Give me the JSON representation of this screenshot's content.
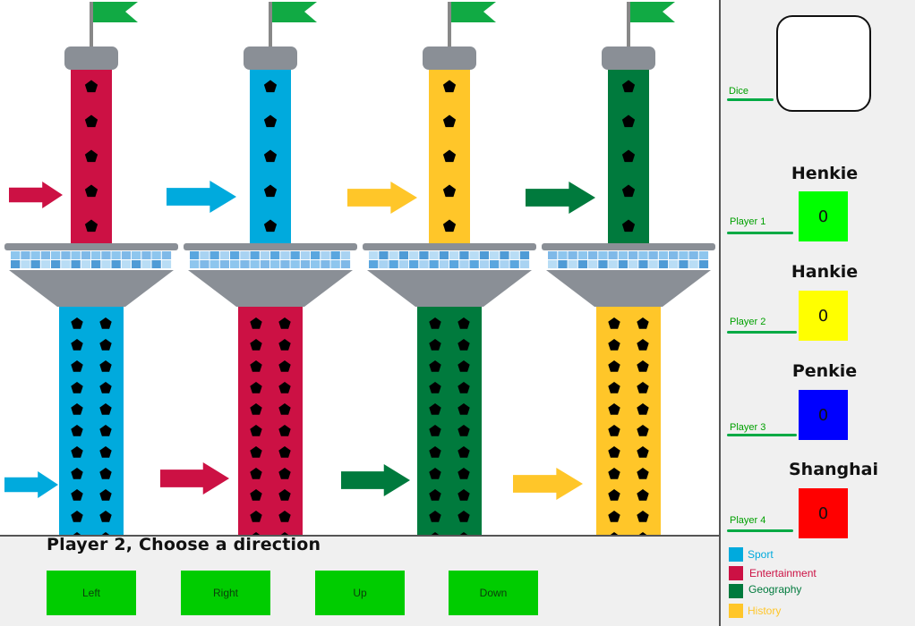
{
  "colors": {
    "sport": "#00aadd",
    "entertainment": "#cc1144",
    "geography": "#007a3d",
    "history": "#ffc629",
    "button_green": "#00cc00",
    "flag": "#11aa44"
  },
  "towers": [
    {
      "top_category": "entertainment",
      "bottom_category": "sport"
    },
    {
      "top_category": "sport",
      "bottom_category": "entertainment"
    },
    {
      "top_category": "history",
      "bottom_category": "geography"
    },
    {
      "top_category": "geography",
      "bottom_category": "history"
    }
  ],
  "controls": {
    "prompt": "Player 2, Choose a direction",
    "buttons": [
      "Left",
      "Right",
      "Up",
      "Down"
    ]
  },
  "sidebar": {
    "dice_label": "Dice",
    "players": [
      {
        "label": "Player 1",
        "name": "Henkie",
        "score": "0",
        "color": "#00ff00"
      },
      {
        "label": "Player 2",
        "name": "Hankie",
        "score": "0",
        "color": "#ffff00"
      },
      {
        "label": "Player 3",
        "name": "Penkie",
        "score": "0",
        "color": "#0000ff"
      },
      {
        "label": "Player 4",
        "name": "Shanghai",
        "score": "0",
        "color": "#ff0000"
      }
    ],
    "legend": [
      {
        "label": "Sport",
        "color": "#00aadd"
      },
      {
        "label": "Entertainment",
        "color": "#cc1144"
      },
      {
        "label": "Geography",
        "color": "#007a3d"
      },
      {
        "label": "History",
        "color": "#ffc629"
      }
    ]
  }
}
